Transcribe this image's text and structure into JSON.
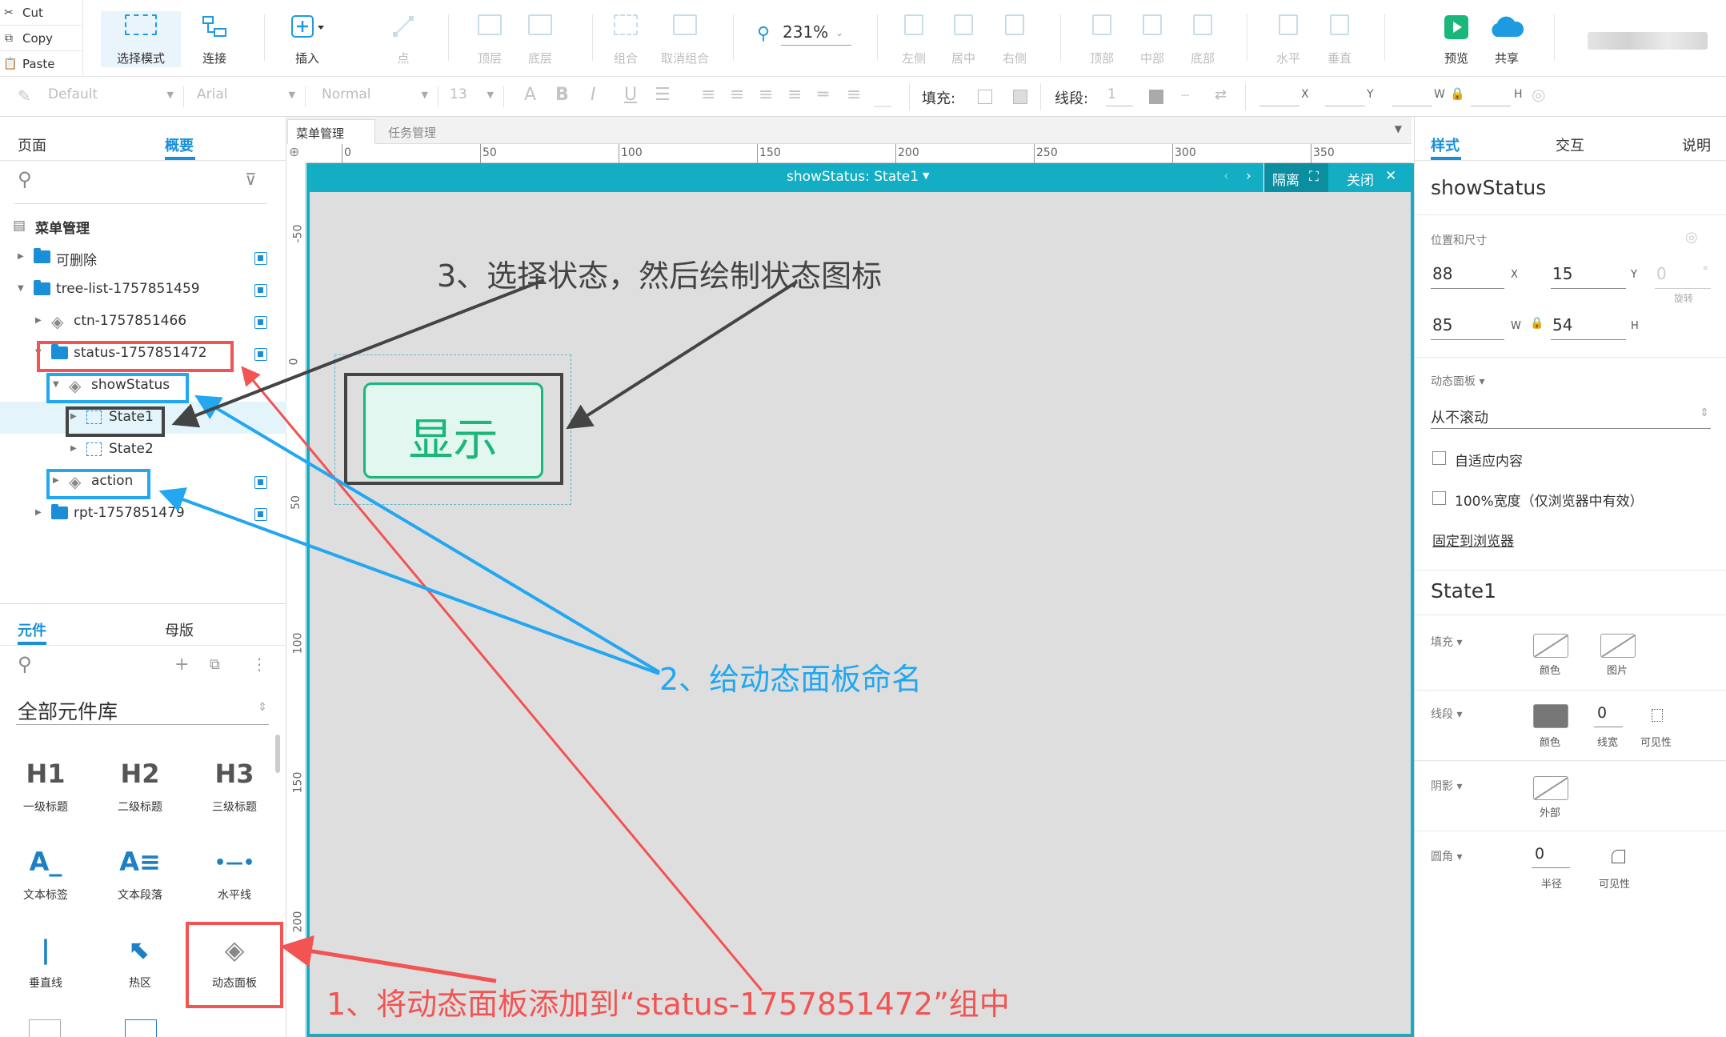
{
  "clipboard": {
    "cut": "Cut",
    "copy": "Copy",
    "paste": "Paste"
  },
  "toolbar": {
    "select_mode": "选择模式",
    "connect": "连接",
    "insert": "插入",
    "point": "点",
    "top_layer": "顶层",
    "bottom_layer": "底层",
    "group": "组合",
    "ungroup": "取消组合",
    "zoom": "231%",
    "align_left": "左侧",
    "align_center": "居中",
    "align_right": "右侧",
    "align_top": "顶部",
    "align_middle": "中部",
    "align_bottom": "底部",
    "distribute_h": "水平",
    "distribute_v": "垂直",
    "preview": "预览",
    "share": "共享"
  },
  "format": {
    "style": "Default",
    "font": "Arial",
    "weight": "Normal",
    "size": "13",
    "fill_label": "填充:",
    "stroke_label": "线段:",
    "stroke_value": "1",
    "x": "X",
    "y": "Y",
    "w": "W",
    "h": "H"
  },
  "left_panel": {
    "tab_pages": "页面",
    "tab_outline": "概要",
    "page_name": "菜单管理",
    "tree": [
      {
        "label": "可删除"
      },
      {
        "label": "tree-list-1757851459"
      },
      {
        "label": "ctn-1757851466"
      },
      {
        "label": "status-1757851472"
      },
      {
        "label": "showStatus"
      },
      {
        "label": "State1"
      },
      {
        "label": "State2"
      },
      {
        "label": "action"
      },
      {
        "label": "rpt-1757851479"
      }
    ],
    "lib_tab_widgets": "元件",
    "lib_tab_masters": "母版",
    "library_name": "全部元件库",
    "widgets": [
      {
        "glyph": "H1",
        "label": "一级标题"
      },
      {
        "glyph": "H2",
        "label": "二级标题"
      },
      {
        "glyph": "H3",
        "label": "三级标题"
      },
      {
        "glyph": "A_",
        "label": "文本标签"
      },
      {
        "glyph": "A≡",
        "label": "文本段落"
      },
      {
        "glyph": "•—•",
        "label": "水平线"
      },
      {
        "glyph": "|",
        "label": "垂直线"
      },
      {
        "glyph": "⬉",
        "label": "热区"
      },
      {
        "glyph": "◈",
        "label": "动态面板"
      }
    ]
  },
  "doc_tabs": [
    {
      "label": "菜单管理"
    },
    {
      "label": "任务管理"
    }
  ],
  "ruler": {
    "top": [
      "0",
      "50",
      "100",
      "150",
      "200",
      "250",
      "300",
      "350"
    ],
    "left": [
      "-50",
      "0",
      "50",
      "100",
      "150",
      "200"
    ]
  },
  "panel_edit": {
    "title": "showStatus: State1",
    "isolate": "隔离",
    "close": "关闭",
    "button_text": "显示"
  },
  "right_panel": {
    "tab_style": "样式",
    "tab_interaction": "交互",
    "tab_notes": "说明",
    "widget_name": "showStatus",
    "pos_size_label": "位置和尺寸",
    "x": "88",
    "x_label": "X",
    "y": "15",
    "y_label": "Y",
    "rotation": "0",
    "rotation_unit": "°",
    "rotation_label": "旋转",
    "w": "85",
    "w_label": "W",
    "h": "54",
    "h_label": "H",
    "dynamic_panel_label": "动态面板 ▾",
    "scroll": "从不滚动",
    "fit_content": "自适应内容",
    "full_width": "100%宽度（仅浏览器中有效）",
    "pin_browser": "固定到浏览器",
    "state_name": "State1",
    "fill_label": "填充 ▾",
    "fill_color": "颜色",
    "fill_image": "图片",
    "stroke_label": "线段 ▾",
    "stroke_color": "颜色",
    "stroke_width": "0",
    "stroke_width_label": "线宽",
    "stroke_visibility": "可见性",
    "shadow_label": "阴影 ▾",
    "shadow_outer": "外部",
    "radius_label": "圆角 ▾",
    "radius_value": "0",
    "radius_caption": "半径",
    "radius_visibility": "可见性"
  },
  "annotations": {
    "step1": "1、将动态面板添加到“status-1757851472”组中",
    "step2": "2、给动态面板命名",
    "step3": "3、选择状态，然后绘制状态图标"
  },
  "colors": {
    "accent_blue": "#1a8fd8",
    "panel_teal": "#13aec3",
    "annotation_red": "#f25353",
    "annotation_blue": "#22a7f0",
    "annotation_dark": "#444444",
    "button_green": "#1bb77a"
  }
}
